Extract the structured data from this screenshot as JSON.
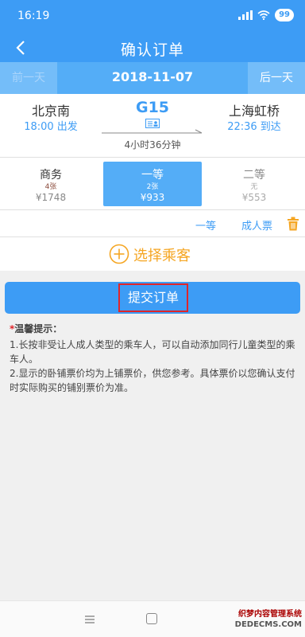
{
  "status": {
    "time": "16:19",
    "battery": "99"
  },
  "nav": {
    "title": "确认订单"
  },
  "date_bar": {
    "prev": "前一天",
    "date": "2018-11-07",
    "next": "后一天"
  },
  "train": {
    "departure_station": "北京南",
    "departure_time": "18:00 出发",
    "number": "G15",
    "duration": "4小时36分钟",
    "arrival_station": "上海虹桥",
    "arrival_time": "22:36 到达"
  },
  "seats": [
    {
      "name": "商务",
      "count": "4张",
      "price": "¥1748"
    },
    {
      "name": "一等",
      "count": "2张",
      "price": "¥933"
    },
    {
      "name": "二等",
      "count": "无",
      "price": "¥553"
    }
  ],
  "passenger": {
    "seat_class": "一等",
    "ticket_type": "成人票"
  },
  "choose_passenger": {
    "label": "选择乘客"
  },
  "submit": {
    "label": "提交订单"
  },
  "tips": {
    "star": "*",
    "title": "温馨提示：",
    "items": [
      "1.长按非受让人成人类型的乘车人，可以自动添加同行儿童类型的乘车人。",
      "2.显示的卧铺票价均为上铺票价，供您参考。具体票价以您确认支付时实际购买的铺别票价为准。"
    ]
  },
  "watermark": {
    "name": "织梦内容管理系统",
    "url": "DEDECMS.COM"
  },
  "colors": {
    "primary": "#3d9cf5",
    "accent": "#f5a623",
    "danger": "#e0252a"
  }
}
